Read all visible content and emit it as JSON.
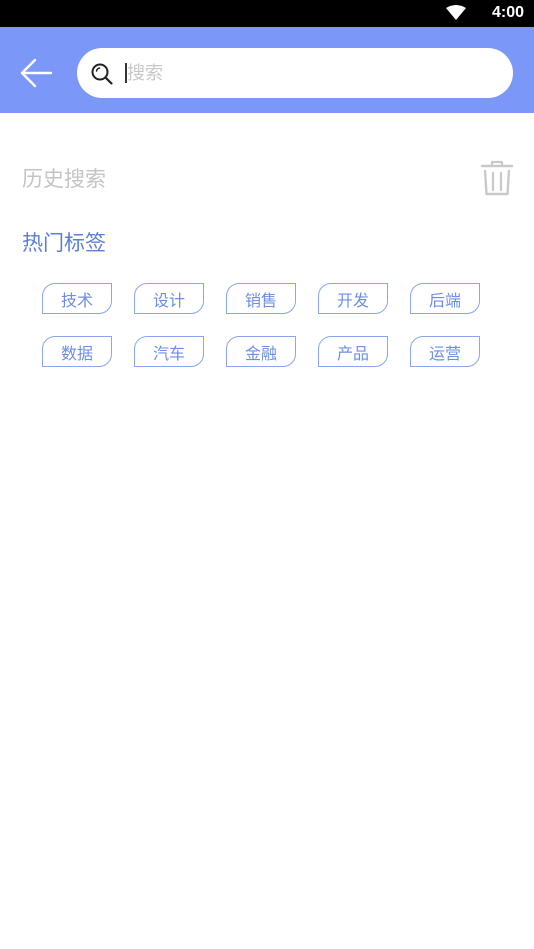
{
  "status_bar": {
    "time": "4:00",
    "wifi_icon": "wifi-icon"
  },
  "header": {
    "back_icon": "arrow-left-icon",
    "search": {
      "icon": "search-icon",
      "value": "",
      "placeholder": "搜索"
    }
  },
  "history": {
    "title": "历史搜索",
    "clear_icon": "trash-icon"
  },
  "hot_tags": {
    "title": "热门标签",
    "items": [
      "技术",
      "设计",
      "销售",
      "开发",
      "后端",
      "数据",
      "汽车",
      "金融",
      "产品",
      "运营"
    ]
  },
  "colors": {
    "app_bar": "#7b97f7",
    "accent": "#5b7fd6",
    "tag_text": "#6e8ee6",
    "tag_border": "#8aa6f0",
    "muted": "#c4c4c4"
  }
}
